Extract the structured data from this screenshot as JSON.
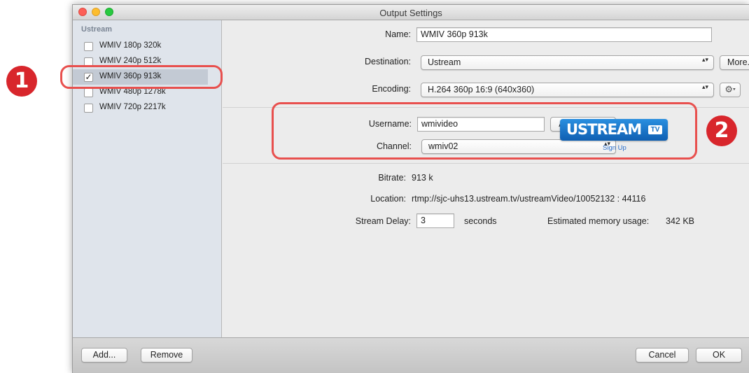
{
  "window": {
    "title": "Output Settings"
  },
  "sidebar": {
    "header": "Ustream",
    "items": [
      {
        "label": "WMIV 180p 320k",
        "checked": false
      },
      {
        "label": "WMIV 240p 512k",
        "checked": false
      },
      {
        "label": "WMIV 360p 913k",
        "checked": true
      },
      {
        "label": "WMIV 480p 1278k",
        "checked": false
      },
      {
        "label": "WMIV 720p 2217k",
        "checked": false
      }
    ],
    "check_mark": "✓"
  },
  "form": {
    "name_label": "Name:",
    "name_value": "WMIV 360p 913k",
    "destination_label": "Destination:",
    "destination_value": "Ustream",
    "more_label": "More...",
    "encoding_label": "Encoding:",
    "encoding_value": "H.264 360p 16:9 (640x360)",
    "gear_icon": "⚙",
    "caret_icon": "▾",
    "popup_arrows": "▴▾"
  },
  "account": {
    "username_label": "Username:",
    "username_value": "wmivideo",
    "authenticate_label": "Authenticate",
    "channel_label": "Channel:",
    "channel_value": "wmiv02",
    "logo_text": "USTREAM",
    "logo_tv": "TV",
    "signup_label": "Sign Up"
  },
  "info": {
    "bitrate_label": "Bitrate:",
    "bitrate_value": "913 k",
    "location_label": "Location:",
    "location_value": "rtmp://sjc-uhs13.ustream.tv/ustreamVideo/10052132 : 44116",
    "stream_delay_label": "Stream Delay:",
    "stream_delay_value": "3",
    "seconds_label": "seconds",
    "memory_label": "Estimated memory usage:",
    "memory_value": "342 KB"
  },
  "bottom": {
    "add_label": "Add...",
    "remove_label": "Remove",
    "cancel_label": "Cancel",
    "ok_label": "OK"
  },
  "annotations": {
    "badge1": "1",
    "badge2": "2",
    "color": "#d8262c"
  }
}
